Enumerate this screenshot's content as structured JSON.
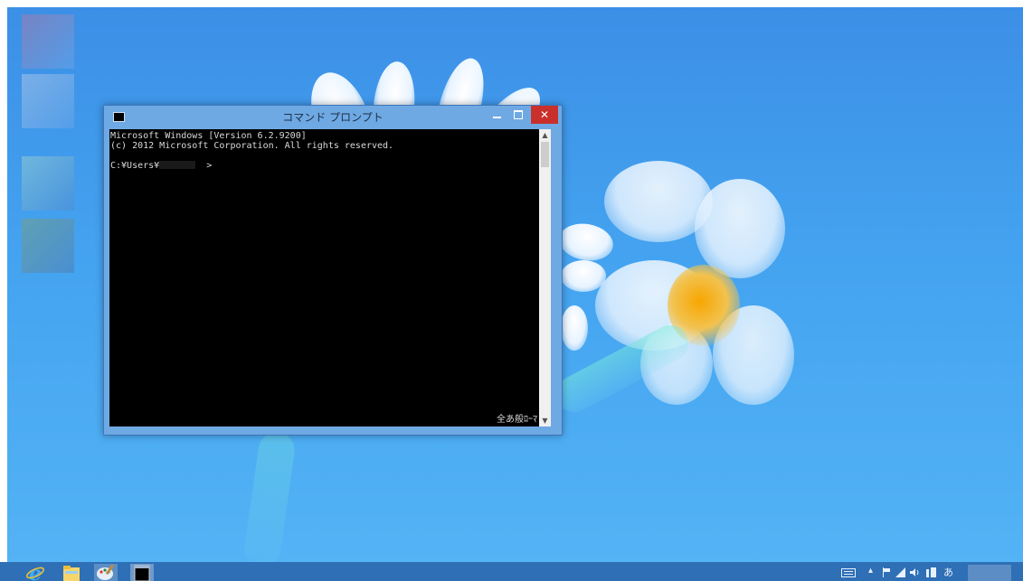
{
  "window": {
    "title": "コマンド プロンプト"
  },
  "console": {
    "line1": "Microsoft Windows [Version 6.2.9200]",
    "line2": "(c) 2012 Microsoft Corporation. All rights reserved.",
    "prompt_prefix": "C:¥Users¥",
    "prompt_suffix": ">",
    "ime_status": "全あ般ﾛｰﾏ"
  },
  "tray": {
    "ime_mode": "あ"
  },
  "icons": {
    "taskbar": [
      "internet-explorer-icon",
      "file-explorer-icon",
      "paint-icon",
      "command-prompt-icon"
    ],
    "tray": [
      "touch-keyboard-icon",
      "show-hidden-icons-icon",
      "action-center-flag-icon",
      "network-icon",
      "volume-icon",
      "ime-pad-icon"
    ]
  },
  "colors": {
    "desktop_blue": "#44a3f0",
    "taskbar": "#2f6fb5",
    "window_frame": "#6fa9e3",
    "close_button": "#c9302c",
    "console_bg": "#000000",
    "console_text": "#d9d9d9"
  }
}
